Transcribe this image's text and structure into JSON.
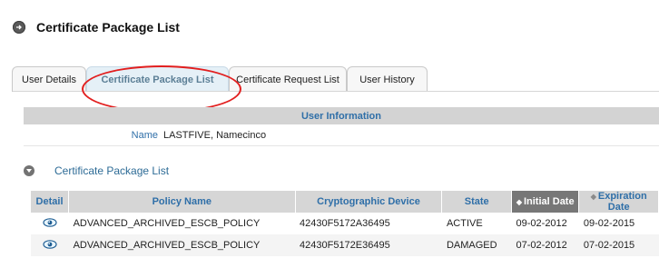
{
  "page": {
    "title": "Certificate Package List"
  },
  "tabs": [
    {
      "label": "User Details",
      "active": false
    },
    {
      "label": "Certificate Package List",
      "active": true
    },
    {
      "label": "Certificate Request List",
      "active": false
    },
    {
      "label": "User History",
      "active": false
    }
  ],
  "user_info": {
    "header": "User Information",
    "name_label": "Name",
    "name_value": "LASTFIVE, Namecinco"
  },
  "section": {
    "title": "Certificate Package List"
  },
  "table": {
    "headers": [
      "Detail",
      "Policy Name",
      "Cryptographic Device",
      "State",
      "Initial Date",
      "Expiration Date"
    ],
    "rows": [
      [
        "ADVANCED_ARCHIVED_ESCB_POLICY",
        "42430F5172A36495",
        "ACTIVE",
        "09-02-2012",
        "09-02-2015"
      ],
      [
        "ADVANCED_ARCHIVED_ESCB_POLICY",
        "42430F5172E36495",
        "DAMAGED",
        "07-02-2012",
        "07-02-2015"
      ]
    ]
  },
  "colors": {
    "accent": "#2f6fa8",
    "annotation": "#e21f1f",
    "active_tab_bg": "#e5f0f7"
  },
  "icons": [
    "circle-arrow-icon",
    "collapse-icon",
    "eye-icon",
    "sort-icon"
  ]
}
